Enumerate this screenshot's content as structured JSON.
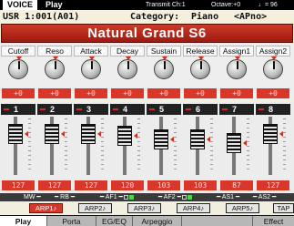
{
  "status": {
    "mode": "VOICE",
    "state": "Play",
    "transmit": "Transmit Ch:1",
    "octave": "Octave:+0",
    "tempo": "♩= 96"
  },
  "voice": {
    "number": "USR 1:001(A01)",
    "category_label": "Category:",
    "category_value": "Piano",
    "sub_category": "<APno>",
    "name": "Natural Grand S6"
  },
  "knobs": [
    {
      "label": "Cutoff",
      "value": "+0"
    },
    {
      "label": "Reso",
      "value": "+0"
    },
    {
      "label": "Attack",
      "value": "+0"
    },
    {
      "label": "Decay",
      "value": "+0"
    },
    {
      "label": "Sustain",
      "value": "+0"
    },
    {
      "label": "Release",
      "value": "+0"
    },
    {
      "label": "Assign1",
      "value": "+0"
    },
    {
      "label": "Assign2",
      "value": "+0"
    }
  ],
  "sliders": [
    {
      "number": "1",
      "value": "127"
    },
    {
      "number": "2",
      "value": "127"
    },
    {
      "number": "3",
      "value": "127"
    },
    {
      "number": "4",
      "value": "120"
    },
    {
      "number": "5",
      "value": "103"
    },
    {
      "number": "6",
      "value": "103"
    },
    {
      "number": "7",
      "value": "87"
    },
    {
      "number": "8",
      "value": "127"
    }
  ],
  "switches": {
    "mw": "MW",
    "rb": "RB",
    "af1": "AF1",
    "af2": "AF2",
    "as1": "AS1",
    "as2": "AS2"
  },
  "arp_buttons": [
    {
      "label": "ARP1♪"
    },
    {
      "label": "ARP2♪"
    },
    {
      "label": "ARP3♪"
    },
    {
      "label": "ARP4♪"
    },
    {
      "label": "ARP5♪"
    },
    {
      "label": "TAP"
    }
  ],
  "tabs": [
    {
      "label": "Play"
    },
    {
      "label": "Porta"
    },
    {
      "label": "EG/EQ"
    },
    {
      "label": "Arpeggio"
    },
    {
      "label": "Effect"
    }
  ],
  "colors": {
    "accent_red": "#d9372a",
    "name_bar_red": "#b02515",
    "switch_on_green": "#4fd34f"
  }
}
